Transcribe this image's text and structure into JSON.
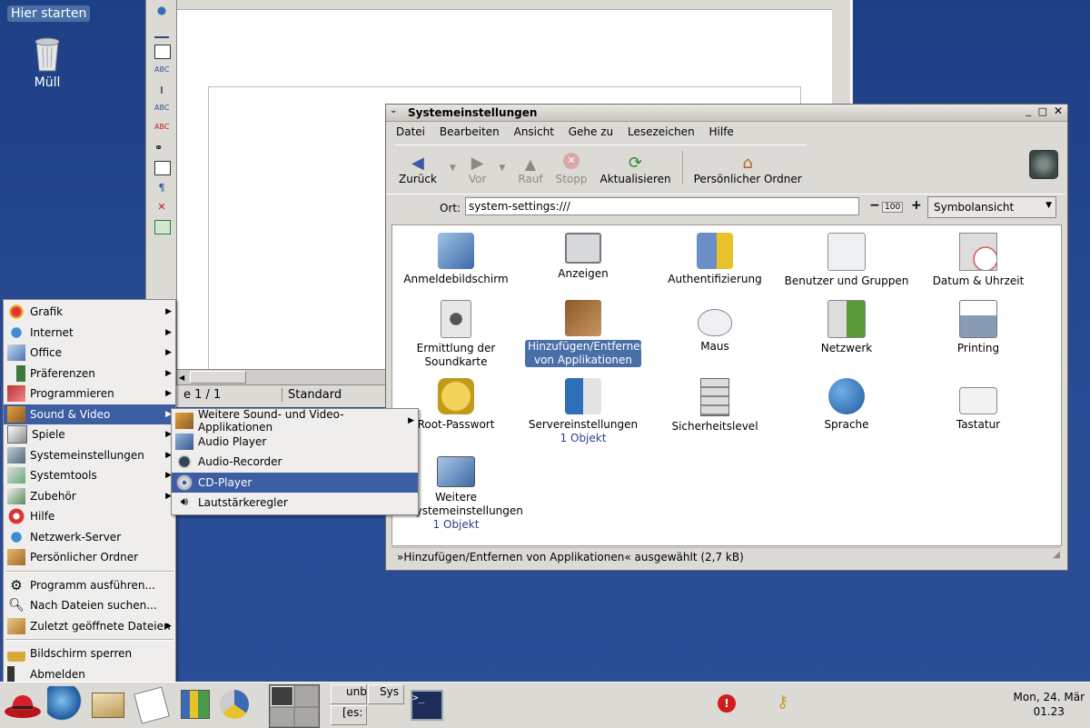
{
  "desktop": {
    "start_label": "Hier starten",
    "trash_label": "Müll"
  },
  "writer": {
    "page_status": "e 1 / 1",
    "style_status": "Standard"
  },
  "sysset": {
    "title": "Systemeinstellungen",
    "menu": [
      "Datei",
      "Bearbeiten",
      "Ansicht",
      "Gehe zu",
      "Lesezeichen",
      "Hilfe"
    ],
    "toolbar": {
      "back": "Zurück",
      "forward": "Vor",
      "up": "Rauf",
      "stop": "Stopp",
      "reload": "Aktualisieren",
      "home": "Persönlicher Ordner"
    },
    "location_label": "Ort:",
    "location_value": "system-settings:///",
    "zoom": "100",
    "view_mode": "Symbolansicht",
    "items": [
      {
        "label": "Anmeldebildschirm"
      },
      {
        "label": "Anzeigen"
      },
      {
        "label": "Authentifizierung"
      },
      {
        "label": "Benutzer und Gruppen"
      },
      {
        "label": "Datum & Uhrzeit"
      },
      {
        "label": "Ermittlung der Soundkarte"
      },
      {
        "label": "Hinzufügen/Entfernen von Applikationen"
      },
      {
        "label": "Maus"
      },
      {
        "label": "Netzwerk"
      },
      {
        "label": "Printing"
      },
      {
        "label": "Root-Passwort"
      },
      {
        "label": "Servereinstellungen",
        "sub": "1 Objekt"
      },
      {
        "label": "Sicherheitslevel"
      },
      {
        "label": "Sprache"
      },
      {
        "label": "Tastatur"
      },
      {
        "label": "Weitere Systemeinstellungen",
        "sub": "1 Objekt"
      }
    ],
    "status": "»Hinzufügen/Entfernen von Applikationen« ausgewählt (2,7 kB)"
  },
  "main_menu": {
    "items": [
      "Grafik",
      "Internet",
      "Office",
      "Präferenzen",
      "Programmieren",
      "Sound & Video",
      "Spiele",
      "Systemeinstellungen",
      "Systemtools",
      "Zubehör",
      "Hilfe",
      "Netzwerk-Server",
      "Persönlicher Ordner",
      "Programm ausführen...",
      "Nach Dateien suchen...",
      "Zuletzt geöffnete Dateien",
      "Bildschirm sperren",
      "Abmelden"
    ]
  },
  "sub_menu": {
    "items": [
      "Weitere Sound- und Video-Applikationen",
      "Audio Player",
      "Audio-Recorder",
      "CD-Player",
      "Lautstärkeregler"
    ]
  },
  "panel": {
    "task1": "unb",
    "task2": "Sys",
    "task3": "[es:",
    "date": "Mon, 24. Mär",
    "time": "01.23"
  },
  "colors": {
    "highlight": "#3d5ea3",
    "desktop": "#274b94"
  }
}
